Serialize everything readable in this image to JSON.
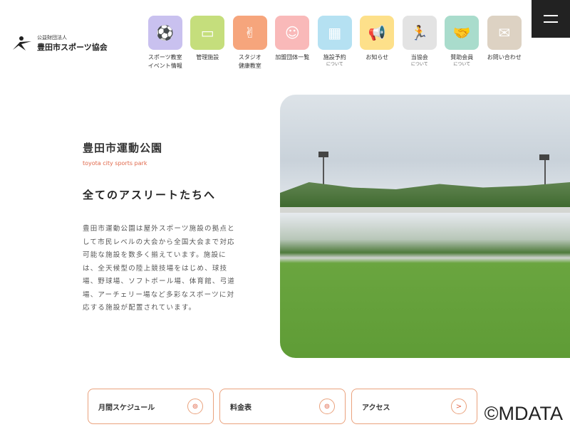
{
  "logo": {
    "small": "公益財団法人",
    "name": "豊田市スポーツ協会"
  },
  "nav": [
    {
      "label": "スポーツ教室\nイベント情報",
      "sub": "",
      "color": "#c9c1ef",
      "icon": "⚽"
    },
    {
      "label": "管理施設",
      "sub": "",
      "color": "#c5de7c",
      "icon": "▭"
    },
    {
      "label": "スタジオ\n健康教室",
      "sub": "",
      "color": "#f6a57c",
      "icon": "✌"
    },
    {
      "label": "加盟団体一覧",
      "sub": "",
      "color": "#f9b9b9",
      "icon": "☺"
    },
    {
      "label": "施設予約",
      "sub": "について",
      "color": "#b5e1f2",
      "icon": "▦"
    },
    {
      "label": "お知らせ",
      "sub": "",
      "color": "#fde08a",
      "icon": "📢"
    },
    {
      "label": "当協会",
      "sub": "について",
      "color": "#e3e3e3",
      "icon": "🏃"
    },
    {
      "label": "賛助会員",
      "sub": "について",
      "color": "#a9dccc",
      "icon": "🤝"
    },
    {
      "label": "お問い合わせ",
      "sub": "",
      "color": "#ddd2c3",
      "icon": "✉"
    }
  ],
  "main": {
    "title": "豊田市運動公園",
    "subtitle": "toyota city sports park",
    "heading": "全てのアスリートたちへ",
    "body": "豊田市運動公園は屋外スポーツ施設の拠点として市民レベルの大会から全国大会まで対応可能な施設を数多く揃えています。施設には、全天候型の陸上競技場をはじめ、球技場、野球場、ソフトボール場、体育館、弓道場、アーチェリー場など多彩なスポーツに対応する施設が配置されています。"
  },
  "buttons": [
    {
      "label": "月間スケジュール",
      "icon": "⊚"
    },
    {
      "label": "料金表",
      "icon": "⊚"
    },
    {
      "label": "アクセス",
      "icon": ">"
    }
  ],
  "watermark": "©MDATA"
}
